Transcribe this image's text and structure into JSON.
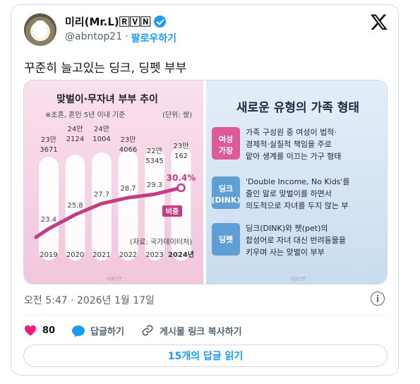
{
  "author": {
    "display_name": "미리(Mr.L)🅁🅅🄽",
    "handle": "@abntop21",
    "follow_label": "팔로우하기"
  },
  "tweet": {
    "text": "꾸준히 늘고있는 딩크, 딩펫 부부",
    "timestamp": "오전 5:47 · 2026년 1월 17일"
  },
  "image": {
    "chart_title": "맞벌이·무자녀 부부 추이",
    "chart_subtitle": "※초혼, 혼인 5년 이내 기준",
    "chart_unit": "(단위: 쌍)",
    "chart_source": "(자료: 국가데이터처)",
    "series_label": "비중",
    "credit": "서울신문",
    "right_title": "새로운 유형의 가족 형태",
    "families": [
      {
        "tag_lines": [
          "여성",
          "가장"
        ],
        "tag_color": "#dd5b9a",
        "lines": [
          "가족 구성원 중 여성이 법적·",
          "경제적·실질적 책임을 주로",
          "맡아 생계를 이끄는 가구 형태"
        ]
      },
      {
        "tag_lines": [
          "딩크",
          "(DINK)"
        ],
        "tag_color": "#5f9fd4",
        "lines": [
          "'Double Income, No Kids'를",
          "줄인 말로 맞벌이를 하면서",
          "의도적으로 자녀를 두지 않는 부"
        ]
      },
      {
        "tag_lines": [
          "딩펫"
        ],
        "tag_color": "#5f9fd4",
        "lines": [
          "딩크(DINK)와 펫(pet)의",
          "합성어로 자녀 대신 반려동물을",
          "키우며 사는 맞벌이 부부"
        ]
      }
    ]
  },
  "chart_data": {
    "type": "line",
    "title": "맞벌이·무자녀 부부 추이",
    "x": [
      "2019",
      "2020",
      "2021",
      "2022",
      "2023",
      "2024년"
    ],
    "counts": [
      "23만 3671",
      "24만 2124",
      "24만 1004",
      "23만 4066",
      "22만 5345",
      "23만 162"
    ],
    "series": [
      {
        "name": "비중",
        "values": [
          23.4,
          25.8,
          27.7,
          28.7,
          29.3,
          30.4
        ]
      }
    ],
    "point_labels": [
      "23.4",
      "25.8",
      "27.7",
      "28.7",
      "29.3",
      "30.4%"
    ],
    "ylim": [
      20,
      32
    ],
    "color": "#c23d84"
  },
  "actions": {
    "like_count": "80",
    "reply_label": "답글하기",
    "copy_link_label": "게시물 링크 복사하기",
    "read_replies_label": "15개의 답글 읽기"
  },
  "colors": {
    "accent": "#1d9bf0",
    "like": "#f91880",
    "chart_pink": "#c23d84"
  }
}
